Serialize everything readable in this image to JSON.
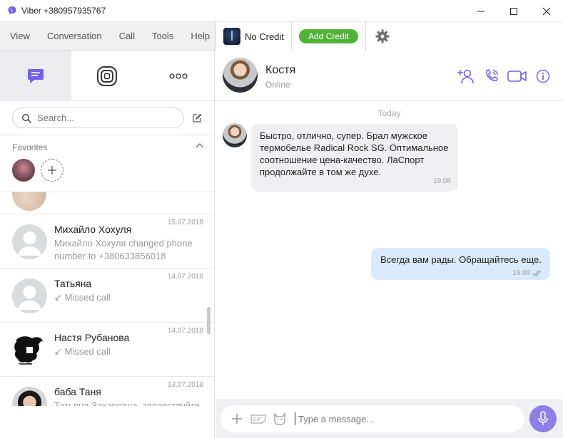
{
  "window": {
    "title": "Viber +380957935767"
  },
  "menu": {
    "items": [
      "View",
      "Conversation",
      "Call",
      "Tools",
      "Help"
    ]
  },
  "account": {
    "credit_status": "No Credit",
    "add_credit_label": "Add Credit"
  },
  "search": {
    "placeholder": "Search..."
  },
  "favorites": {
    "label": "Favorites"
  },
  "chats": [
    {
      "name": "Михайло Хохуля",
      "preview": "Михайло Хохуля changed phone number to +380633856018",
      "date": "15.07.2018"
    },
    {
      "name": "Татьяна",
      "preview": "↙ Missed call",
      "date": "14.07.2018"
    },
    {
      "name": "Настя Рубанова",
      "preview": "↙ Missed call",
      "date": "14.07.2018"
    },
    {
      "name": "баба Таня",
      "preview": "Татьяна Захаровна, здравствуйте. Вы когда-то девочкам покупали ...",
      "date": "13.07.2018"
    }
  ],
  "conversation": {
    "contact_name": "Костя",
    "contact_status": "Online",
    "day_label": "Today",
    "messages": [
      {
        "direction": "in",
        "text": "Быстро, отлично, супер. Брал мужское термобелье Radical Rock SG. Оптимальное соотношение цена-качество. ЛаСпорт продолжайте в том же духе.",
        "time": "19:08"
      },
      {
        "direction": "out",
        "text": "Всегда вам рады. Обращайтесь еще.",
        "time": "19:09"
      }
    ],
    "composer_placeholder": "Type a message..."
  },
  "colors": {
    "accent": "#7360f2",
    "add_credit_green": "#50b337",
    "outgoing_bubble": "#d9ebfb",
    "incoming_bubble": "#efeff1"
  }
}
